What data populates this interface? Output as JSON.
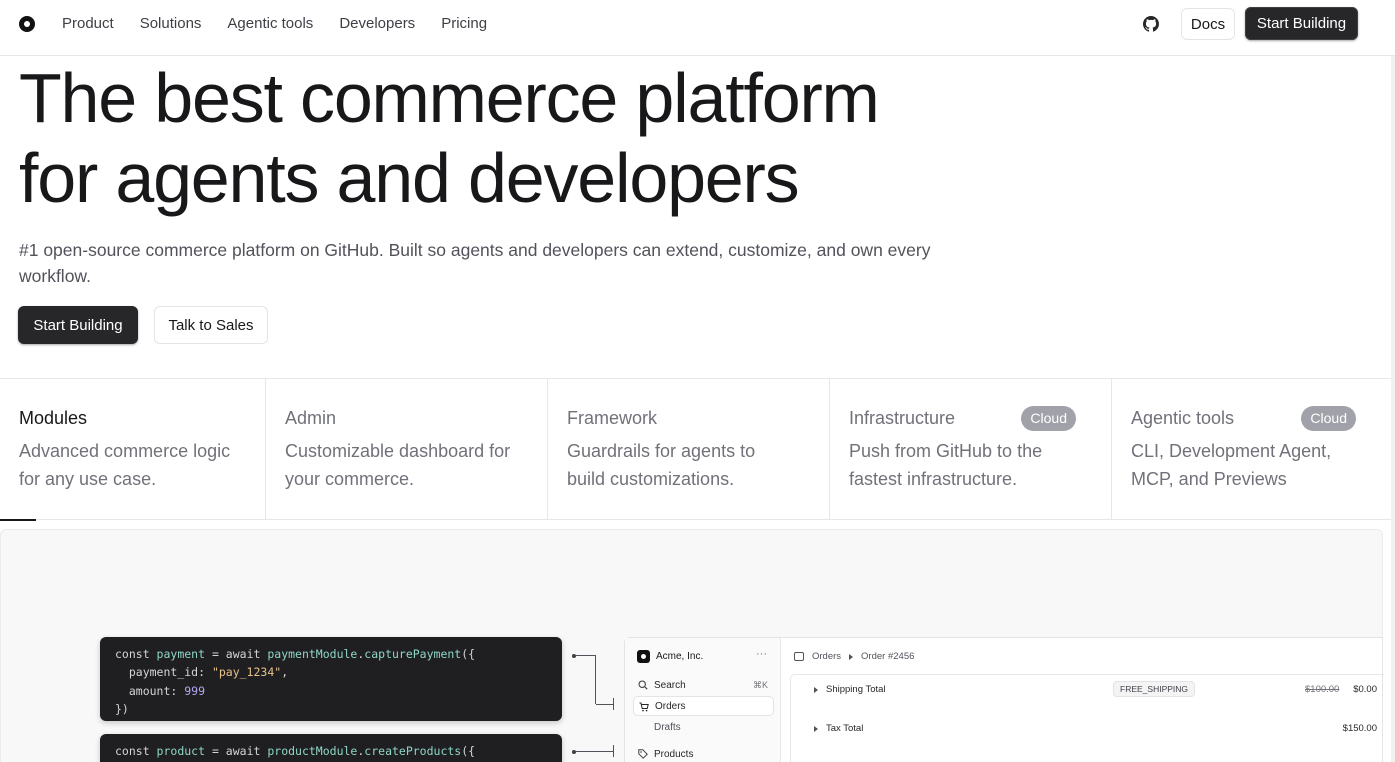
{
  "nav": {
    "links": [
      "Product",
      "Solutions",
      "Agentic tools",
      "Developers",
      "Pricing"
    ],
    "docs_label": "Docs",
    "start_label": "Start Building"
  },
  "hero": {
    "title_line1": "The best commerce platform",
    "title_line2": "for agents and developers",
    "subtitle": "#1 open-source commerce platform on GitHub. Built so agents and developers can extend, customize, and own every workflow.",
    "cta_primary": "Start Building",
    "cta_secondary": "Talk to Sales"
  },
  "features": [
    {
      "title": "Modules",
      "desc": "Advanced commerce logic for any use case.",
      "badge": "",
      "active": true
    },
    {
      "title": "Admin",
      "desc": "Customizable dashboard for your commerce.",
      "badge": "",
      "active": false
    },
    {
      "title": "Framework",
      "desc": "Guardrails for agents to build customizations.",
      "badge": "",
      "active": false
    },
    {
      "title": "Infrastructure",
      "desc": "Push from GitHub to the fastest infrastructure.",
      "badge": "Cloud",
      "active": false
    },
    {
      "title": "Agentic tools",
      "desc": "CLI, Development Agent, MCP, and Previews",
      "badge": "Cloud",
      "active": false
    }
  ],
  "code": {
    "block1": {
      "line1_kw": "const ",
      "line1_var": "payment",
      "line1_eq": " = ",
      "line1_await": "await ",
      "line1_obj": "paymentModule",
      "line1_dot": ".",
      "line1_fn": "capturePayment",
      "line1_end": "({",
      "line2_key": "  payment_id: ",
      "line2_val": "\"pay_1234\"",
      "line2_end": ",",
      "line3_key": "  amount: ",
      "line3_val": "999",
      "line4": "})"
    },
    "block2": {
      "line1_kw": "const ",
      "line1_var": "product",
      "line1_eq": " = ",
      "line1_await": "await ",
      "line1_obj": "productModule",
      "line1_dot": ".",
      "line1_fn": "createProducts",
      "line1_end": "({"
    }
  },
  "admin": {
    "store_name": "Acme, Inc.",
    "menu_glyph": "···",
    "search_label": "Search",
    "search_shortcut": "⌘K",
    "orders_label": "Orders",
    "drafts_label": "Drafts",
    "products_label": "Products",
    "breadcrumb": [
      "Orders",
      "Order #2456"
    ],
    "rows": [
      {
        "label": "Shipping Total",
        "chip": "FREE_SHIPPING",
        "strike": "$100.00",
        "value": "$0.00"
      },
      {
        "label": "Tax Total",
        "chip": "",
        "strike": "",
        "value": "$150.00"
      }
    ]
  },
  "colors": {
    "primary_button": "#27272a",
    "badge": "#a1a1aa",
    "code_bg": "#1f1f22"
  }
}
